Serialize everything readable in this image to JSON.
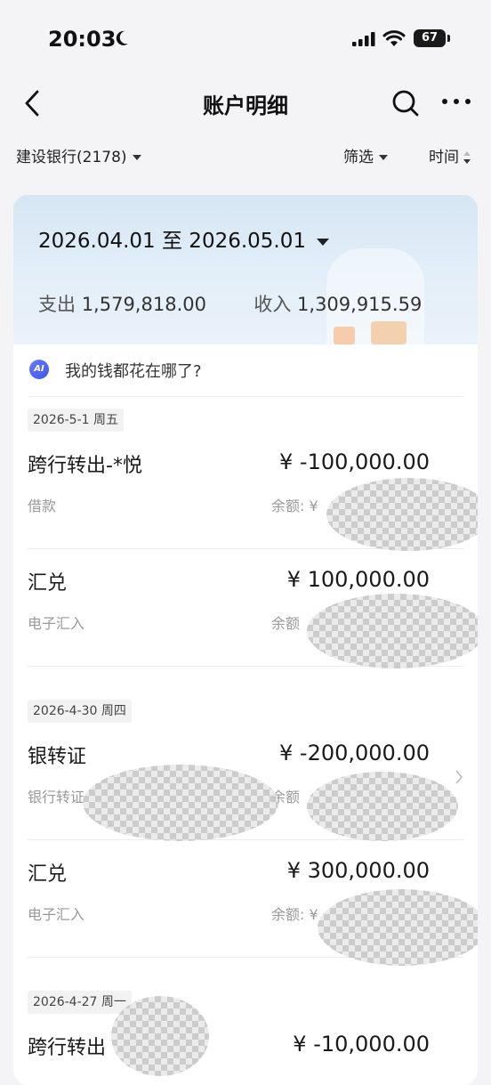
{
  "status": {
    "time": "20:03",
    "battery": "67"
  },
  "nav": {
    "title": "账户明细"
  },
  "filters": {
    "account": "建设银行(2178)",
    "filter": "筛选",
    "time": "时间"
  },
  "summary": {
    "date_range": "2026.04.01 至 2026.05.01",
    "expense_label": "支出",
    "expense": "1,579,818.00",
    "income_label": "收入",
    "income": "1,309,915.59"
  },
  "ai": {
    "badge": "AI",
    "prompt": "我的钱都花在哪了?"
  },
  "days": [
    {
      "date": "2026-5-1 周五",
      "transactions": [
        {
          "name": "跨行转出-*悦",
          "sub": "借款",
          "amount": "¥ -100,000.00",
          "balance": "余额: ¥"
        },
        {
          "name": "汇兑",
          "sub": "电子汇入",
          "amount": "¥ 100,000.00",
          "balance": "余额"
        }
      ]
    },
    {
      "date": "2026-4-30 周四",
      "transactions": [
        {
          "name": "银转证",
          "sub": "银行转证",
          "amount": "¥ -200,000.00",
          "balance": "余额"
        },
        {
          "name": "汇兑",
          "sub": "电子汇入",
          "amount": "¥ 300,000.00",
          "balance": "余额: ¥"
        }
      ]
    },
    {
      "date": "2026-4-27 周一",
      "transactions": [
        {
          "name": "跨行转出",
          "amount": "¥ -10,000.00"
        }
      ]
    }
  ]
}
